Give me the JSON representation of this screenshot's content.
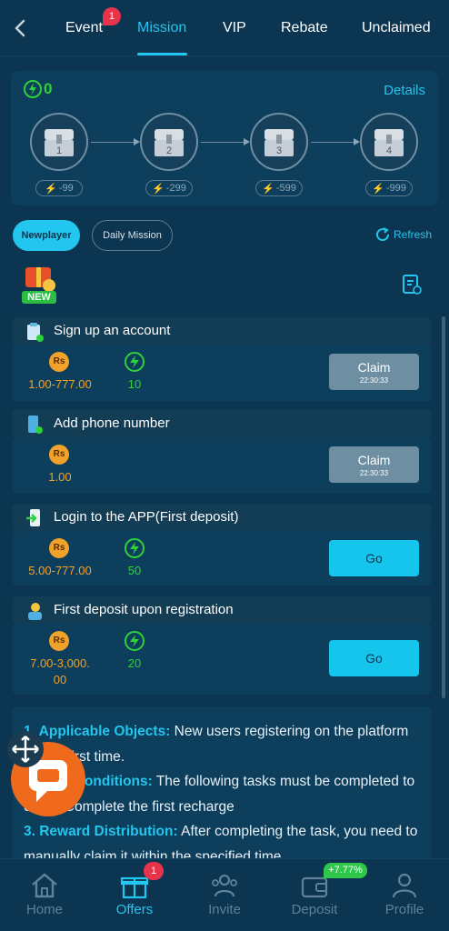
{
  "tabs": [
    {
      "label": "Event",
      "badge": "1"
    },
    {
      "label": "Mission",
      "active": true
    },
    {
      "label": "VIP"
    },
    {
      "label": "Rebate"
    },
    {
      "label": "Unclaimed"
    }
  ],
  "energy": {
    "value": "0",
    "details_label": "Details"
  },
  "chests": [
    {
      "number": "1",
      "requirement": "-99"
    },
    {
      "number": "2",
      "requirement": "-299"
    },
    {
      "number": "3",
      "requirement": "-599"
    },
    {
      "number": "4",
      "requirement": "-999"
    }
  ],
  "mission_types": {
    "active": "Newplayer",
    "inactive": "Daily Mission"
  },
  "refresh_label": "Refresh",
  "new_badge": "NEW",
  "currency_symbol": "Rs",
  "tasks": [
    {
      "title": "Sign up an account",
      "rs_value": "1.00-777.00",
      "bolt_value": "10",
      "button": "Claim",
      "timer": "22:30:33"
    },
    {
      "title": "Add phone number",
      "rs_value": "1.00",
      "button": "Claim",
      "timer": "22:30:33"
    },
    {
      "title": "Login to the APP(First deposit)",
      "rs_value": "5.00-777.00",
      "bolt_value": "50",
      "button": "Go"
    },
    {
      "title": "First deposit upon registration",
      "rs_value_line1": "7.00-3,000.",
      "rs_value_line2": "00",
      "bolt_value": "20",
      "button": "Go"
    }
  ],
  "rules": [
    {
      "heading": "1. Applicable Objects:",
      "text": " New users registering on the platform for the first time."
    },
    {
      "heading": "2. Task Conditions:",
      "text": " The following tasks must be completed to claim: Complete the first recharge"
    },
    {
      "heading": "3. Reward Distribution:",
      "text": " After completing the task, you need to manually claim it within the specified time."
    }
  ],
  "bottom_nav": [
    {
      "label": "Home"
    },
    {
      "label": "Offers",
      "active": true,
      "badge": "1"
    },
    {
      "label": "Invite"
    },
    {
      "label": "Deposit",
      "badge": "+7.77%"
    },
    {
      "label": "Profile"
    }
  ],
  "colors": {
    "accent": "#23c6ee",
    "energy": "#2fd13a",
    "currency": "#f0a22a",
    "background": "#0b3550"
  }
}
